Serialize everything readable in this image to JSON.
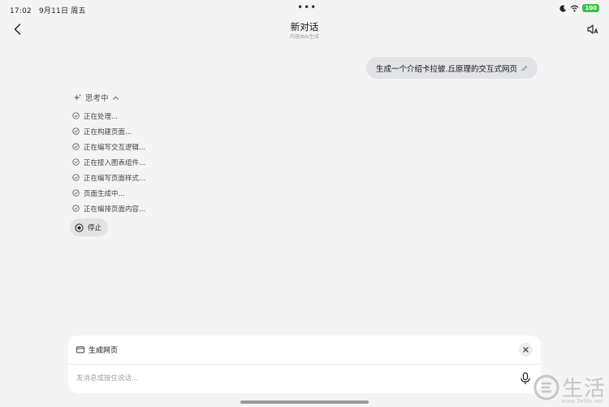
{
  "status_bar": {
    "time": "17:02",
    "date": "9月11日 周五",
    "dots": "•••",
    "battery": "100"
  },
  "header": {
    "title": "新对话",
    "subtitle": "内容由AI生成"
  },
  "user_message": "生成一个介绍卡拉彼.丘原理的交互式网页",
  "thinking": {
    "label": "思考中",
    "steps": [
      "正在处理...",
      "正在构建页面...",
      "正在编写交互逻辑...",
      "正在接入图表组件...",
      "正在编写页面样式...",
      "页面生成中...",
      "正在编排页面内容..."
    ]
  },
  "stop_label": "停止",
  "composer": {
    "tool_label": "生成网页",
    "placeholder": "发消息或按住说话..."
  },
  "watermark": {
    "text": "生活",
    "url": "www.3elife.net"
  },
  "icons": {
    "back": "chevron-left-icon",
    "speaker": "speaker-icon",
    "edit": "pencil-icon",
    "sparkle": "sparkle-icon",
    "chevron_up": "chevron-up-icon",
    "check": "check-circle-icon",
    "stop": "stop-circle-icon",
    "webpage": "browser-window-icon",
    "close": "close-icon",
    "mic": "microphone-icon"
  },
  "colors": {
    "background": "#f4f4f4",
    "bubble": "#e2e3e7",
    "battery": "#3dc24a"
  }
}
